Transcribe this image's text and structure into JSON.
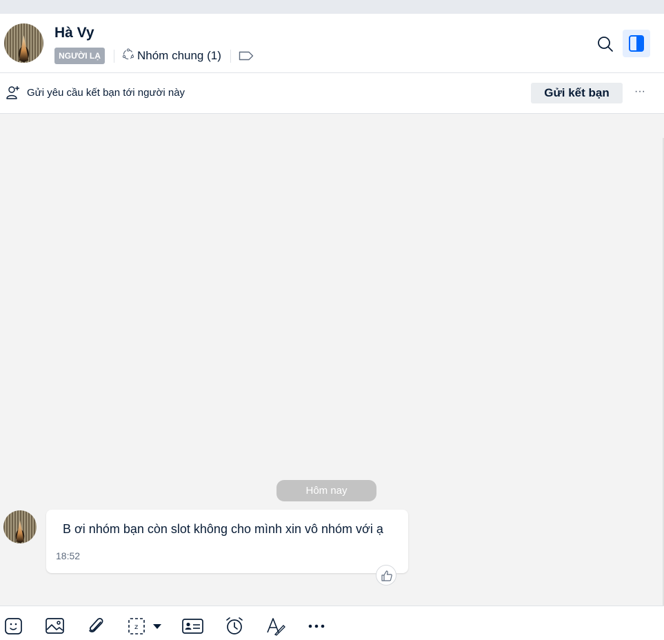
{
  "header": {
    "name": "Hà Vy",
    "badge": "NGƯỜI LẠ",
    "group_label": "Nhóm chung (1)",
    "avatar_icon": "avatar-image",
    "icons": [
      "group-icon",
      "tag-icon",
      "search-icon",
      "panel-toggle-icon"
    ]
  },
  "request_bar": {
    "text": "Gửi yêu cầu kết bạn tới người này",
    "button": "Gửi kết bạn",
    "more": "···",
    "icon": "add-user-icon"
  },
  "chat": {
    "date_separator": "Hôm nay",
    "messages": [
      {
        "text": "B ơi nhóm bạn còn slot không cho mình xin vô nhóm với ạ",
        "time": "18:52"
      }
    ]
  },
  "toolbar": {
    "icons": [
      "sticker-icon",
      "image-icon",
      "attachment-icon",
      "screenshot-icon",
      "chevron-down-icon",
      "contact-card-icon",
      "reminder-icon",
      "text-format-icon",
      "more-icon"
    ]
  },
  "colors": {
    "accent": "#0068ff",
    "panel_active_bg": "#e5efff",
    "chat_bg": "#f3f3f3",
    "badge_bg": "#a4abb6",
    "date_pill_bg": "#c3c3c3"
  }
}
